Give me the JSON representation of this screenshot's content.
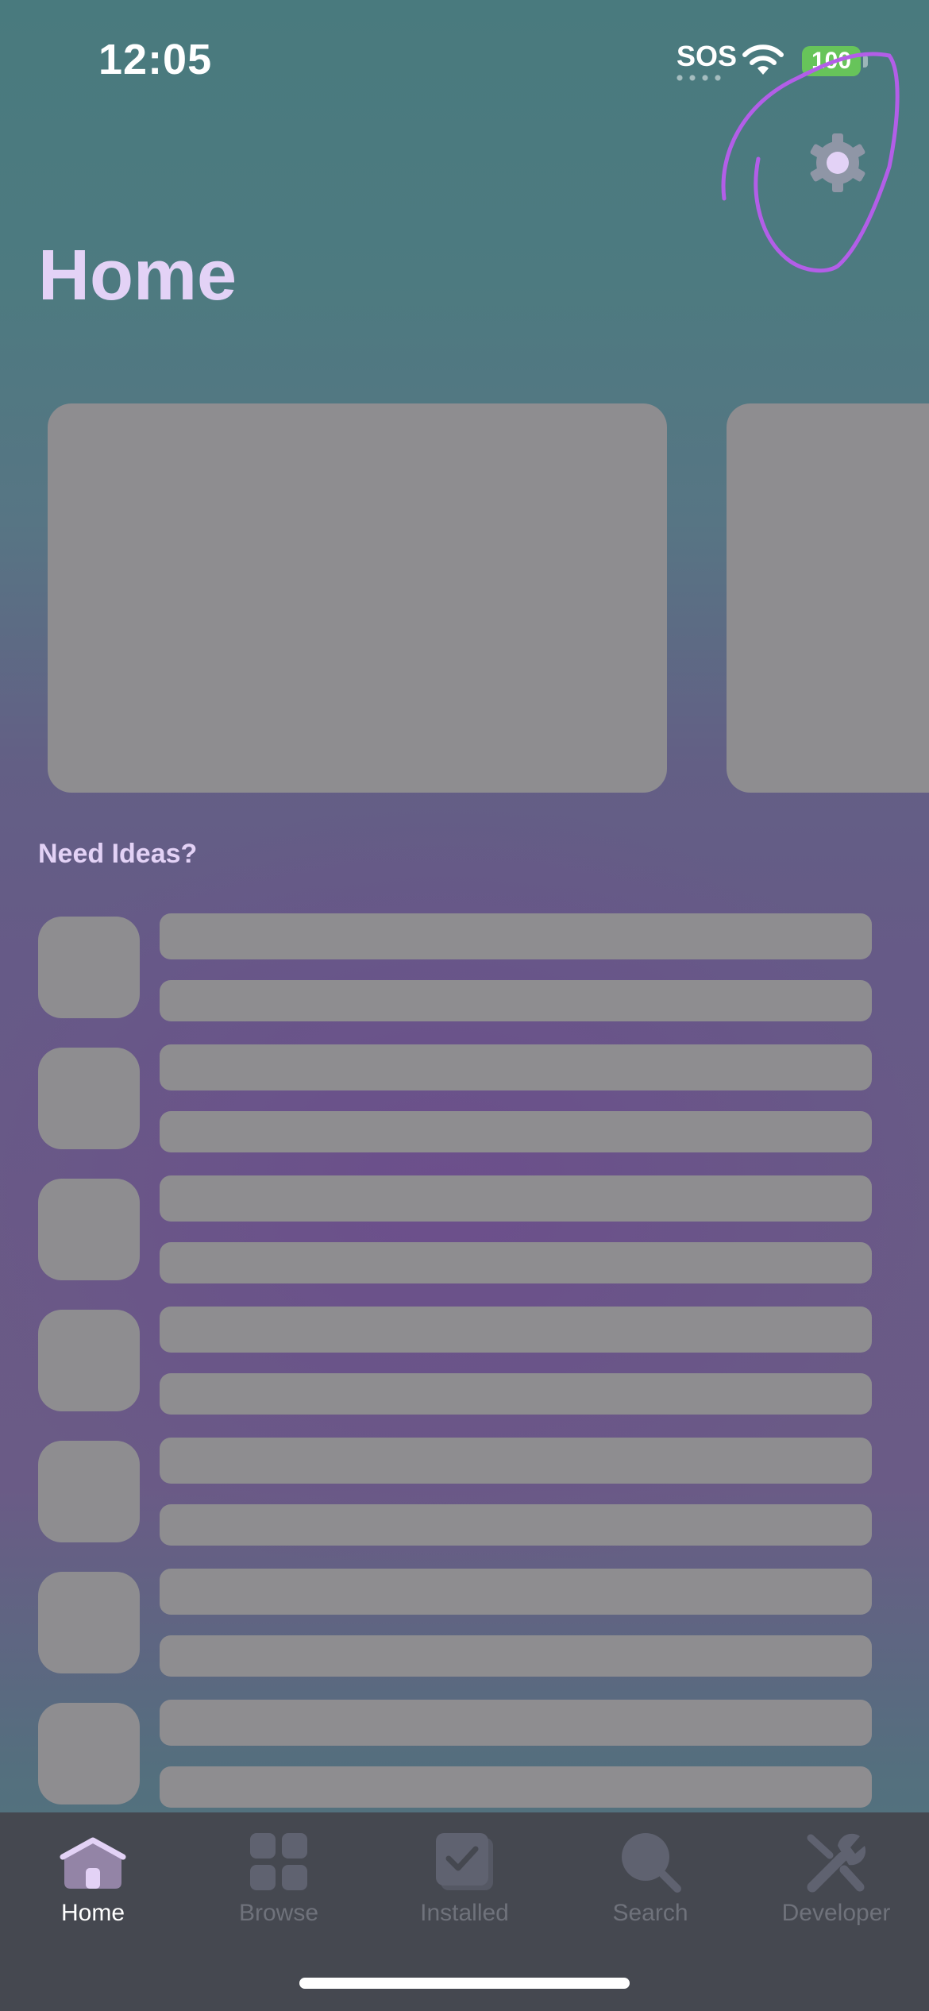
{
  "status_bar": {
    "time": "12:05",
    "carrier_status": "SOS",
    "battery_level": "100",
    "icons": [
      "wifi-icon",
      "battery-icon"
    ]
  },
  "header": {
    "title": "Home",
    "settings_icon": "gear-icon"
  },
  "featured": {
    "placeholder_cards": 2
  },
  "ideas": {
    "title": "Need Ideas?",
    "placeholder_rows": 7
  },
  "tab_bar": {
    "tabs": [
      {
        "label": "Home",
        "icon": "home-icon",
        "active": true
      },
      {
        "label": "Browse",
        "icon": "grid-icon",
        "active": false
      },
      {
        "label": "Installed",
        "icon": "checkbox-icon",
        "active": false
      },
      {
        "label": "Search",
        "icon": "search-icon",
        "active": false
      },
      {
        "label": "Developer",
        "icon": "wrench-icon",
        "active": false
      }
    ]
  },
  "colors": {
    "title_lavender": "#e3d2f6",
    "skeleton_gray": "#8e8d90",
    "annotation_purple": "#b35ee8",
    "battery_green": "#67c45a",
    "tab_bar_bg": "#454850"
  }
}
